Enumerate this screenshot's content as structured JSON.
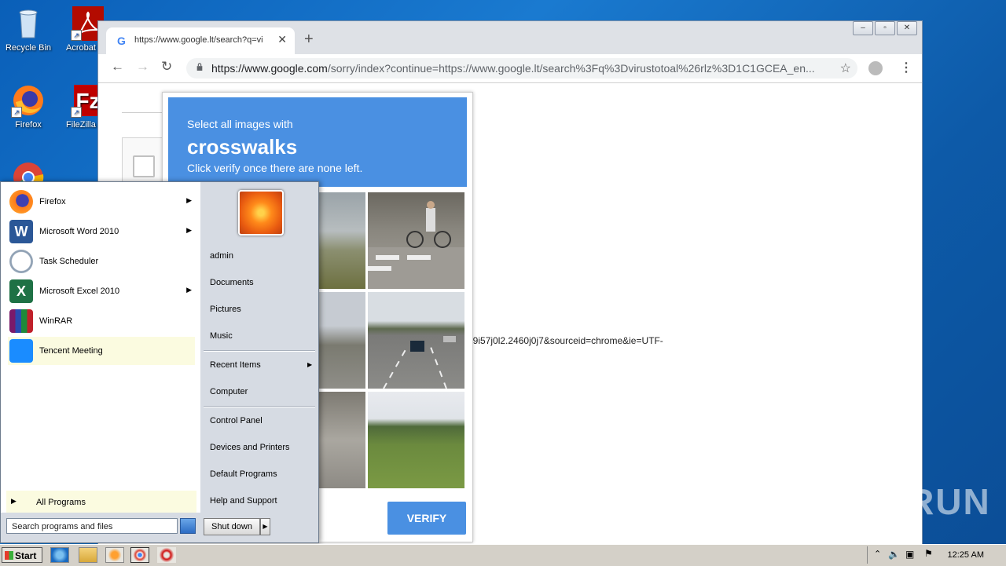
{
  "desktop": {
    "icons": [
      {
        "label": "Recycle Bin"
      },
      {
        "label": "Acrobat Reader DC"
      },
      {
        "label": "Firefox"
      },
      {
        "label": "FileZilla Client"
      },
      {
        "label": "Google Chrome"
      }
    ]
  },
  "browser": {
    "tab_title": "https://www.google.lt/search?q=vi",
    "url_scheme_host": "https://www.google.com",
    "url_rest": "/sorry/index?continue=https://www.google.lt/search%3Fq%3Dvirustotoal%26rlz%3D1C1GCEA_en...",
    "page_fragment": "59i57j0l2.2460j0j7&sourceid=chrome&ie=UTF-"
  },
  "captcha": {
    "line1": "Select all images with",
    "keyword": "crosswalks",
    "line3": "Click verify once there are none left.",
    "verify_label": "VERIFY"
  },
  "start_menu": {
    "programs": [
      {
        "label": "Firefox",
        "has_arrow": true
      },
      {
        "label": "Microsoft Word 2010",
        "has_arrow": true
      },
      {
        "label": "Task Scheduler",
        "has_arrow": false
      },
      {
        "label": "Microsoft Excel 2010",
        "has_arrow": true
      },
      {
        "label": "WinRAR",
        "has_arrow": false
      },
      {
        "label": "Tencent Meeting",
        "has_arrow": false
      }
    ],
    "all_programs": "All Programs",
    "search_placeholder": "Search programs and files",
    "shutdown": "Shut down",
    "right_items": [
      "admin",
      "Documents",
      "Pictures",
      "Music",
      "Recent Items",
      "Computer",
      "Control Panel",
      "Devices and Printers",
      "Default Programs",
      "Help and Support"
    ]
  },
  "taskbar": {
    "start_label": "Start",
    "clock": "12:25 AM"
  },
  "watermark": "ANY RUN",
  "colors": {
    "captcha_blue": "#4a90e2",
    "desktop_blue": "#1a7ad0",
    "highlight": "#fbfbe0"
  }
}
